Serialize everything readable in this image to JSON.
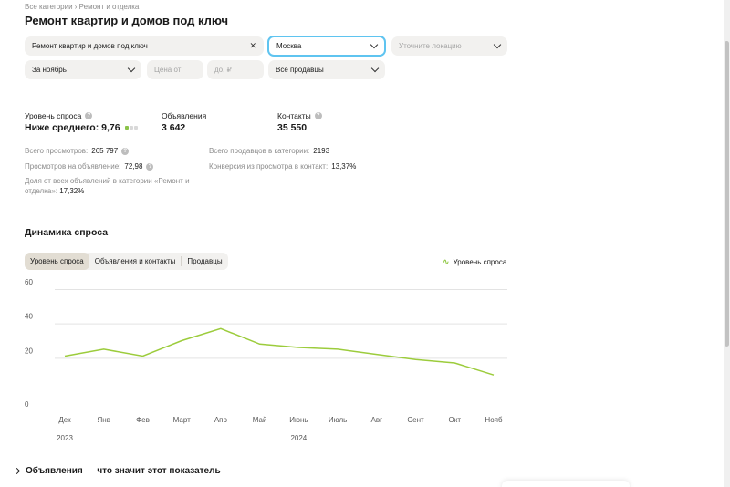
{
  "breadcrumb": "Все категории › Ремонт и отделка",
  "title": "Ремонт квартир и домов под ключ",
  "filters": {
    "category": {
      "value": "Ремонт квартир и домов под ключ",
      "clear_icon": "close-icon"
    },
    "city": {
      "value": "Москва"
    },
    "location": {
      "placeholder": "Уточните локацию"
    },
    "period": {
      "value": "За ноябрь"
    },
    "price_from": {
      "placeholder": "Цена от"
    },
    "price_to": {
      "placeholder": "до, ₽"
    },
    "sellers": {
      "value": "Все продавцы"
    }
  },
  "stats": {
    "demand": {
      "label": "Уровень спроса",
      "value": "Ниже среднего: 9,76",
      "level": 1,
      "level_max": 3
    },
    "listings": {
      "label": "Объявления",
      "value": "3 642"
    },
    "contacts": {
      "label": "Контакты",
      "value": "35 550"
    }
  },
  "metrics": {
    "total_views": {
      "label": "Всего просмотров:",
      "value": "265 797"
    },
    "views_per_listing": {
      "label": "Просмотров на объявление:",
      "value": "72,98"
    },
    "share": {
      "label": "Доля от всех объявлений в категории «Ремонт и отделка»:",
      "value": "17,32%"
    },
    "total_sellers": {
      "label": "Всего продавцов в категории:",
      "value": "2193"
    },
    "conversion": {
      "label": "Конверсия из просмотра в контакт:",
      "value": "13,37%"
    }
  },
  "dynamics": {
    "title": "Динамика спроса",
    "tabs": [
      "Уровень спроса",
      "Объявления и контакты",
      "Продавцы"
    ],
    "active_tab": 0,
    "legend": "Уровень спроса",
    "line_color": "#9ccc3c"
  },
  "chart_data": {
    "type": "line",
    "categories": [
      "Дек",
      "Янв",
      "Фев",
      "Март",
      "Апр",
      "Май",
      "Июнь",
      "Июль",
      "Авг",
      "Сент",
      "Окт",
      "Нояб"
    ],
    "year_labels": [
      {
        "at": "Дек",
        "label": "2023"
      },
      {
        "at": "Июнь",
        "label": "2024"
      }
    ],
    "series": [
      {
        "name": "Уровень спроса",
        "values": [
          21,
          25,
          21,
          30,
          37,
          28,
          26,
          25,
          22,
          19,
          17,
          10
        ]
      }
    ],
    "y_ticks": [
      "0",
      "20",
      "40",
      "60"
    ],
    "ylim": [
      0,
      60
    ],
    "grid": true,
    "legend": "top-right"
  },
  "footer": {
    "expander": "Объявления — что значит этот показатель"
  }
}
